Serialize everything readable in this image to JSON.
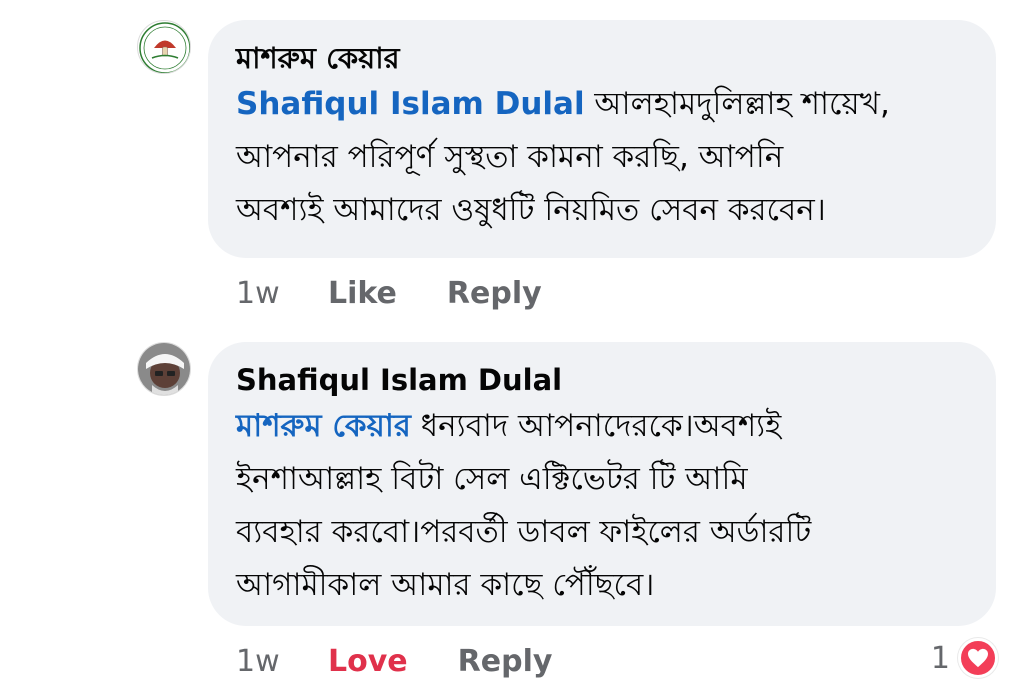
{
  "comments": [
    {
      "author": "মাশরুম কেয়ার",
      "avatar": "mushroom-care-logo",
      "avatar_text": "মাশরুম কেয়ার",
      "mention": "Shafiqul Islam Dulal",
      "lines": [
        " আলহামদুলিল্লাহ শায়েখ,",
        "আপনার পরিপূর্ণ সুস্থতা কামনা করছি, আপনি",
        "অবশ্যই আমাদের ওষুধটি নিয়মিত সেবন করবেন।"
      ],
      "time": "1w",
      "like_label": "Like",
      "reply_label": "Reply"
    },
    {
      "author": "Shafiqul Islam Dulal",
      "avatar": "profile-photo",
      "mention": "মাশরুম কেয়ার",
      "lines": [
        " ধন্যবাদ আপনাদেরকে।অবশ্যই",
        "ইনশাআল্লাহ বিটা সেল এক্টিভেটর টি আমি",
        "ব্যবহার করবো।পরবর্তী  ডাবল ফাইলের অর্ডারটি",
        "আগামীকাল আমার কাছে পৌঁছবে।"
      ],
      "time": "1w",
      "love_label": "Love",
      "reply_label": "Reply",
      "reaction_count": "1",
      "reaction_icon": "heart-icon",
      "reaction_color": "#f33e58"
    }
  ],
  "colors": {
    "bubble": "#f0f2f5",
    "mention": "#1565c0",
    "meta": "#65676b",
    "love": "#e0314b"
  }
}
